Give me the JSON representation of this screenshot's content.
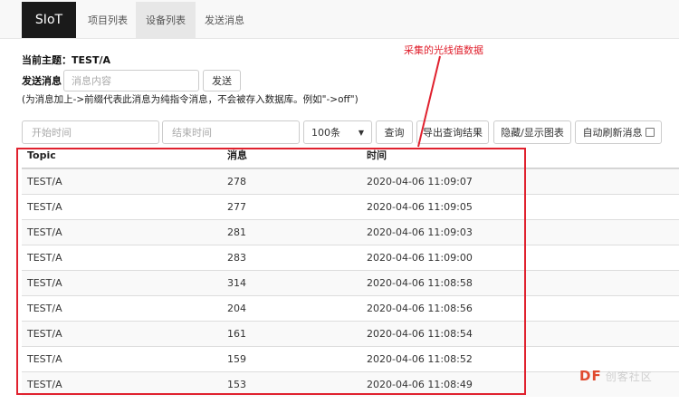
{
  "navbar": {
    "brand": "SIoT",
    "items": [
      {
        "label": "项目列表",
        "active": false
      },
      {
        "label": "设备列表",
        "active": true
      },
      {
        "label": "发送消息",
        "active": false
      }
    ]
  },
  "topic": {
    "label": "当前主题：TEST/A"
  },
  "send": {
    "label": "发送消息",
    "placeholder": "消息内容",
    "button": "发送",
    "hint": "(为消息加上->前缀代表此消息为纯指令消息，不会被存入数据库。例如\"->off\")"
  },
  "filters": {
    "start_placeholder": "开始时间",
    "end_placeholder": "结束时间",
    "limit": "100条",
    "query_button": "查询",
    "export_button": "导出查询结果",
    "chart_button": "隐藏/显示图表",
    "autorefresh_button": "自动刷新消息"
  },
  "table": {
    "columns": [
      "Topic",
      "消息",
      "时间"
    ],
    "rows": [
      [
        "TEST/A",
        "278",
        "2020-04-06 11:09:07"
      ],
      [
        "TEST/A",
        "277",
        "2020-04-06 11:09:05"
      ],
      [
        "TEST/A",
        "281",
        "2020-04-06 11:09:03"
      ],
      [
        "TEST/A",
        "283",
        "2020-04-06 11:09:00"
      ],
      [
        "TEST/A",
        "314",
        "2020-04-06 11:08:58"
      ],
      [
        "TEST/A",
        "204",
        "2020-04-06 11:08:56"
      ],
      [
        "TEST/A",
        "161",
        "2020-04-06 11:08:54"
      ],
      [
        "TEST/A",
        "159",
        "2020-04-06 11:08:52"
      ],
      [
        "TEST/A",
        "153",
        "2020-04-06 11:08:49"
      ]
    ]
  },
  "annotation": {
    "text": "采集的光线值数据",
    "color": "#e0212e"
  },
  "watermark": {
    "text": "DF",
    "sub": "创客社区"
  },
  "colors": {
    "brand_bg": "#1a1a1a",
    "accent": "#e0212e",
    "navbar_bg": "#f8f8f8"
  }
}
